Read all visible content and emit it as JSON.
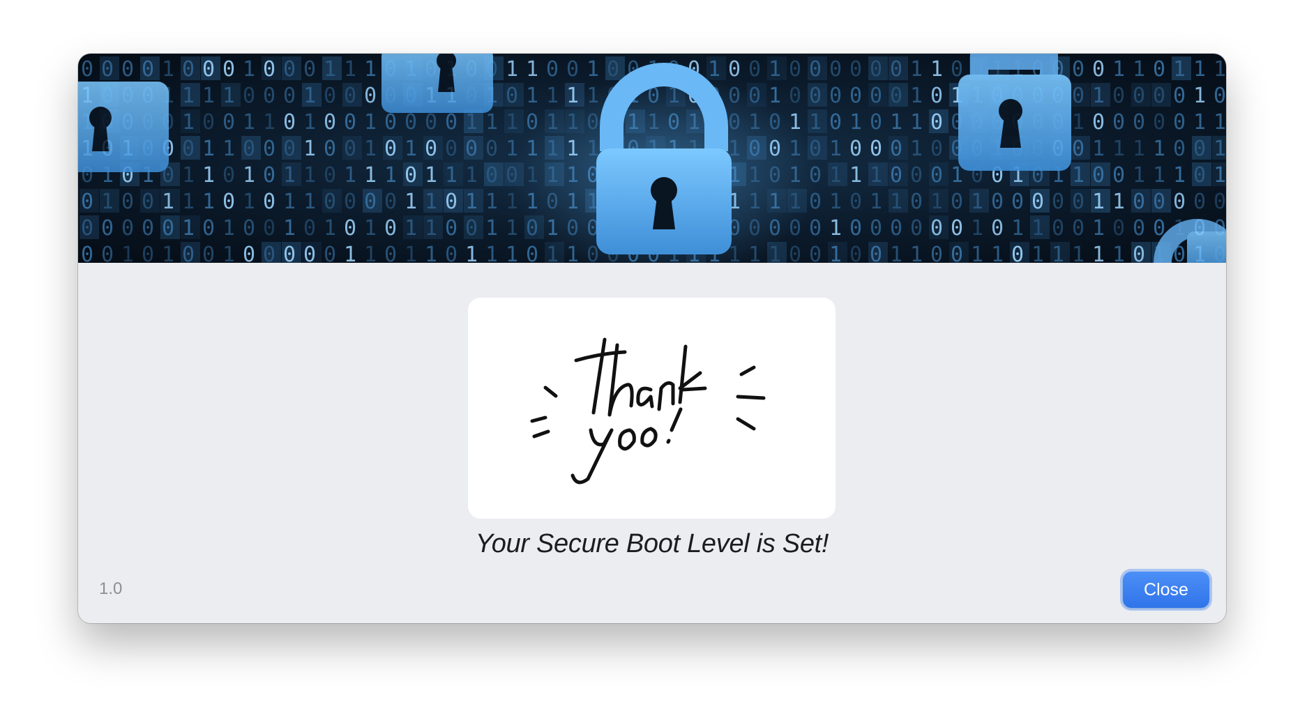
{
  "dialog": {
    "banner_image": "padlock-binary-security-banner",
    "card_image": "thank-you-handwritten-image",
    "message": "Your Secure Boot Level is Set!",
    "version": "1.0",
    "close_label": "Close"
  },
  "colors": {
    "accent": "#2f74ea",
    "background": "#ecedf0",
    "card": "#ffffff",
    "banner_glow": "#5fb8ff"
  }
}
